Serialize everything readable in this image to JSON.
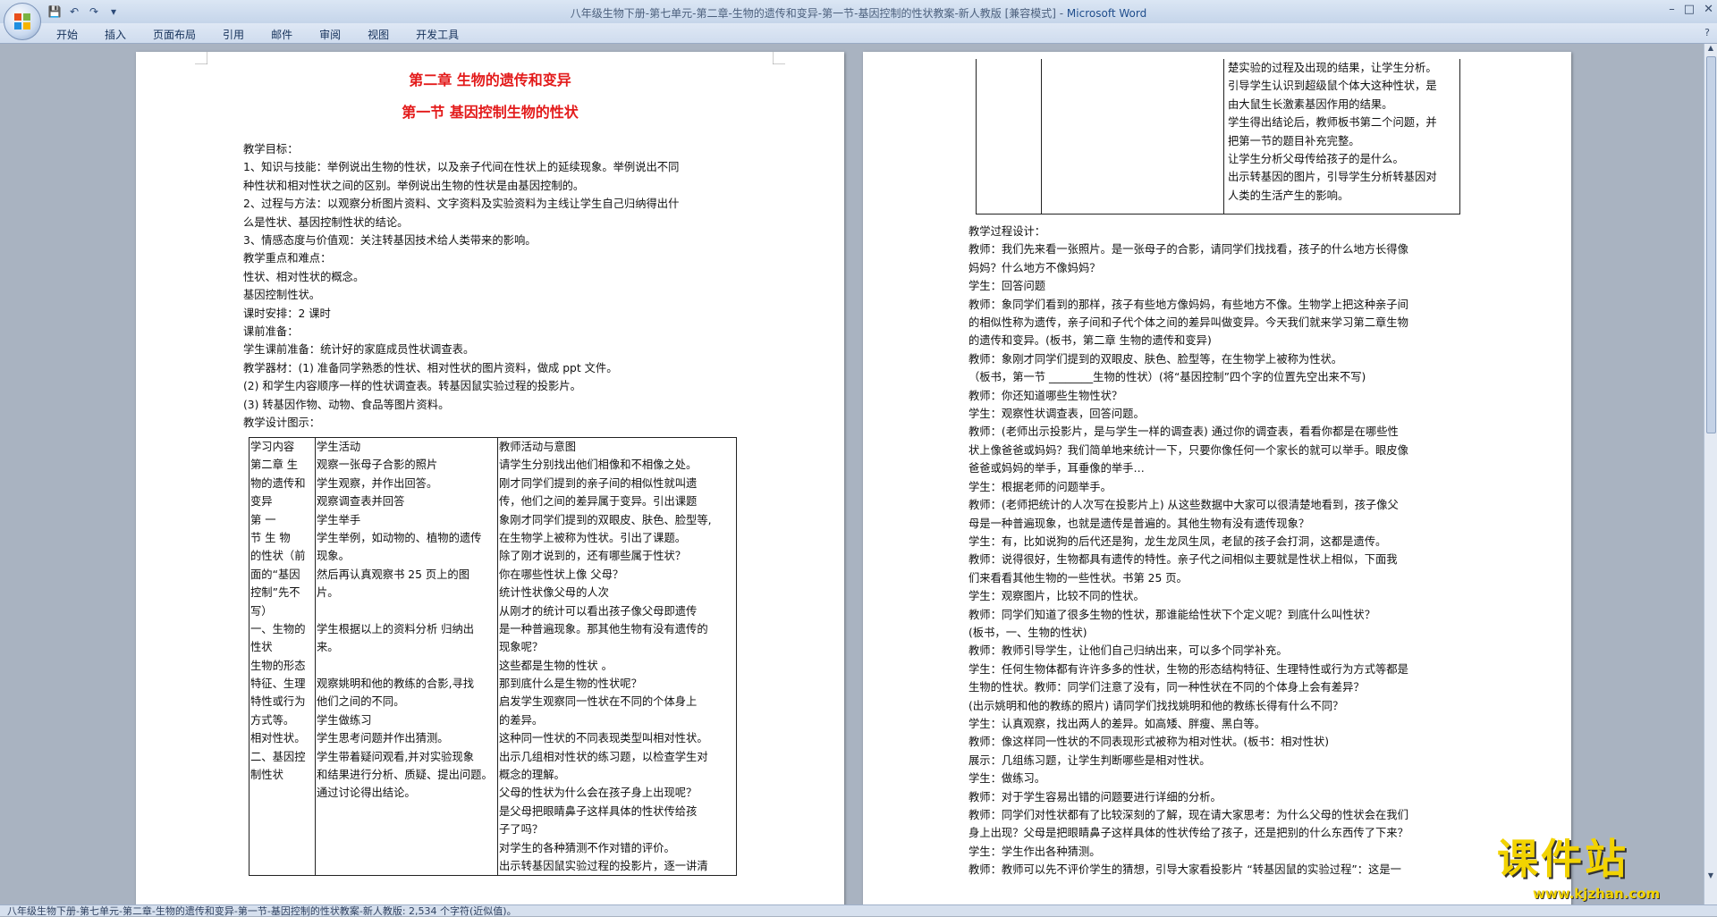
{
  "window": {
    "title": "八年级生物下册-第七单元-第二章-生物的遗传和变异-第一节-基因控制的性状教案-新人教版 [兼容模式] - ",
    "app_name": "Microsoft Word",
    "controls": [
      "–",
      "□",
      "✕"
    ]
  },
  "quick_access": [
    "💾",
    "↶",
    "↷",
    "▾"
  ],
  "ribbon": {
    "tabs": [
      "开始",
      "插入",
      "页面布局",
      "引用",
      "邮件",
      "审阅",
      "视图",
      "开发工具"
    ],
    "help": "?"
  },
  "left_page": {
    "chapter_title": "第二章  生物的遗传和变异",
    "section_title": "第一节  基因控制生物的性状",
    "lines": [
      "教学目标：",
      "1、知识与技能：举例说出生物的性状，以及亲子代间在性状上的延续现象。举例说出不同",
      "种性状和相对性状之间的区别。举例说出生物的性状是由基因控制的。",
      "2、过程与方法：以观察分析图片资料、文字资料及实验资料为主线让学生自己归纳得出什",
      "么是性状、基因控制性状的结论。",
      "3、情感态度与价值观：关注转基因技术给人类带来的影响。",
      "教学重点和难点：",
      "性状、相对性状的概念。",
      "基因控制性状。",
      "课时安排：2 课时",
      "课前准备：",
      "学生课前准备：统计好的家庭成员性状调查表。",
      "教学器材：(1) 准备同学熟悉的性状、相对性状的图片资料，做成 ppt 文件。",
      "(2) 和学生内容顺序一样的性状调查表。转基因鼠实验过程的投影片。",
      "(3) 转基因作物、动物、食品等图片资料。",
      "教学设计图示："
    ],
    "table": {
      "col1": [
        "学习内容",
        "第二章 生",
        "物的遗传和",
        "变异",
        "第       一",
        "节     生 物",
        "的性状（前",
        "面的“基因",
        "控制”先不",
        "写）",
        "一、生物的",
        "性状",
        "生物的形态",
        "特征、生理",
        "特性或行为",
        "方式等。",
        "相对性状。",
        "二、基因控",
        "制性状"
      ],
      "col2": [
        "学生活动",
        "观察一张母子合影的照片",
        "学生观察，并作出回答。",
        "观察调查表并回答",
        "学生举手",
        "学生举例，如动物的、植物的遗传",
        "现象。",
        "然后再认真观察书 25 页上的图",
        "片。",
        "",
        "学生根据以上的资料分析 归纳出",
        "来。",
        "",
        "观察姚明和他的教练的合影,寻找",
        "他们之间的不同。",
        "学生做练习",
        "学生思考问题并作出猜测。",
        "学生带着疑问观看,并对实验现象",
        "和结果进行分析、质疑、提出问题。",
        "通过讨论得出结论。"
      ],
      "col3": [
        "教师活动与意图",
        "请学生分别找出他们相像和不相像之处。",
        "刚才同学们提到的亲子间的相似性就叫遗",
        "传，他们之间的差异属于变异。引出课题",
        "象刚才同学们提到的双眼皮、肤色、脸型等,",
        "在生物学上被称为性状。引出了课题。",
        "除了刚才说到的，还有哪些属于性状？",
        "你在哪些性状上像 父母？",
        "统计性状像父母的人次",
        "从刚才的统计可以看出孩子像父母即遗传",
        "是一种普遍现象。那其他生物有没有遗传的",
        "现象呢？",
        "这些都是生物的性状 。",
        "那到底什么是生物的性状呢？",
        "启发学生观察同一性状在不同的个体身上",
        "的差异。",
        "这种同一性状的不同表现类型叫相对性状。",
        "出示几组相对性状的练习题，以检查学生对",
        "概念的理解。",
        "父母的性状为什么会在孩子身上出现呢？",
        "是父母把眼睛鼻子这样具体的性状传给孩",
        "子了吗？",
        "对学生的各种猜测不作对错的评价。",
        "出示转基因鼠实验过程的投影片，逐一讲清"
      ]
    }
  },
  "right_page": {
    "table_cont": [
      "楚实验的过程及出现的结果，让学生分析。",
      "引导学生认识到超级鼠个体大这种性状，是",
      "由大鼠生长激素基因作用的结果。",
      "学生得出结论后，教师板书第二个问题，并",
      "把第一节的题目补充完整。",
      "让学生分析父母传给孩子的是什么。",
      "出示转基因的图片，引导学生分析转基因对",
      "人类的生活产生的影响。"
    ],
    "lines": [
      "教学过程设计：",
      "教师：我们先来看一张照片。是一张母子的合影，请同学们找找看，孩子的什么地方长得像",
      "妈妈？什么地方不像妈妈？",
      "学生：回答问题",
      "教师：象同学们看到的那样，孩子有些地方像妈妈，有些地方不像。生物学上把这种亲子间",
      "的相似性称为遗传，亲子间和子代个体之间的差异叫做变异。今天我们就来学习第二章生物",
      "的遗传和变异。(板书，第二章 生物的遗传和变异)",
      "教师：象刚才同学们提到的双眼皮、肤色、脸型等，在生物学上被称为性状。",
      "（板书，第一节 ________生物的性状）(将“基因控制”四个字的位置先空出来不写)",
      "教师：你还知道哪些生物性状？",
      "学生：观察性状调查表，回答问题。",
      "教师：(老师出示投影片，是与学生一样的调查表) 通过你的调查表，看看你都是在哪些性",
      "状上像爸爸或妈妈？我们简单地来统计一下，只要你像任何一个家长的就可以举手。眼皮像",
      "爸爸或妈妈的举手，耳垂像的举手…",
      "学生：根据老师的问题举手。",
      "教师：(老师把统计的人次写在投影片上) 从这些数据中大家可以很清楚地看到，孩子像父",
      "母是一种普遍现象，也就是遗传是普遍的。其他生物有没有遗传现象？",
      "学生：有，比如说狗的后代还是狗，龙生龙凤生凤，老鼠的孩子会打洞，这都是遗传。",
      "教师：说得很好，生物都具有遗传的特性。亲子代之间相似主要就是性状上相似，下面我",
      "们来看看其他生物的一些性状。书第 25 页。",
      "学生：观察图片，比较不同的性状。",
      "教师：同学们知道了很多生物的性状，那谁能给性状下个定义呢？到底什么叫性状？",
      "(板书，一、生物的性状)",
      "教师：教师引导学生，让他们自己归纳出来，可以多个同学补充。",
      "学生：任何生物体都有许许多多的性状，生物的形态结构特征、生理特性或行为方式等都是",
      "生物的性状。教师：同学们注意了没有，同一种性状在不同的个体身上会有差异？",
      "(出示姚明和他的教练的照片) 请同学们找找姚明和他的教练长得有什么不同？",
      "学生：认真观察，找出两人的差异。如高矮、胖瘦、黑白等。",
      "教师：像这样同一性状的不同表现形式被称为相对性状。(板书：相对性状)",
      "展示：几组练习题，让学生判断哪些是相对性状。",
      "学生：做练习。",
      "教师：对于学生容易出错的问题要进行详细的分析。",
      "教师：同学们对性状都有了比较深刻的了解，现在请大家思考：为什么父母的性状会在我们",
      "身上出现？父母是把眼睛鼻子这样具体的性状传给了孩子，还是把别的什么东西传了下来？",
      "学生：学生作出各种猜测。",
      "教师：教师可以先不评价学生的猜想，引导大家看投影片 “转基因鼠的实验过程”：这是一"
    ]
  },
  "status_bar": "八年级生物下册-第七单元-第二章-生物的遗传和变异-第一节-基因控制的性状教案-新人教版: 2,534 个字符(近似值)。",
  "watermark": {
    "text": "课件站",
    "url": "www.kjzhan.com"
  }
}
